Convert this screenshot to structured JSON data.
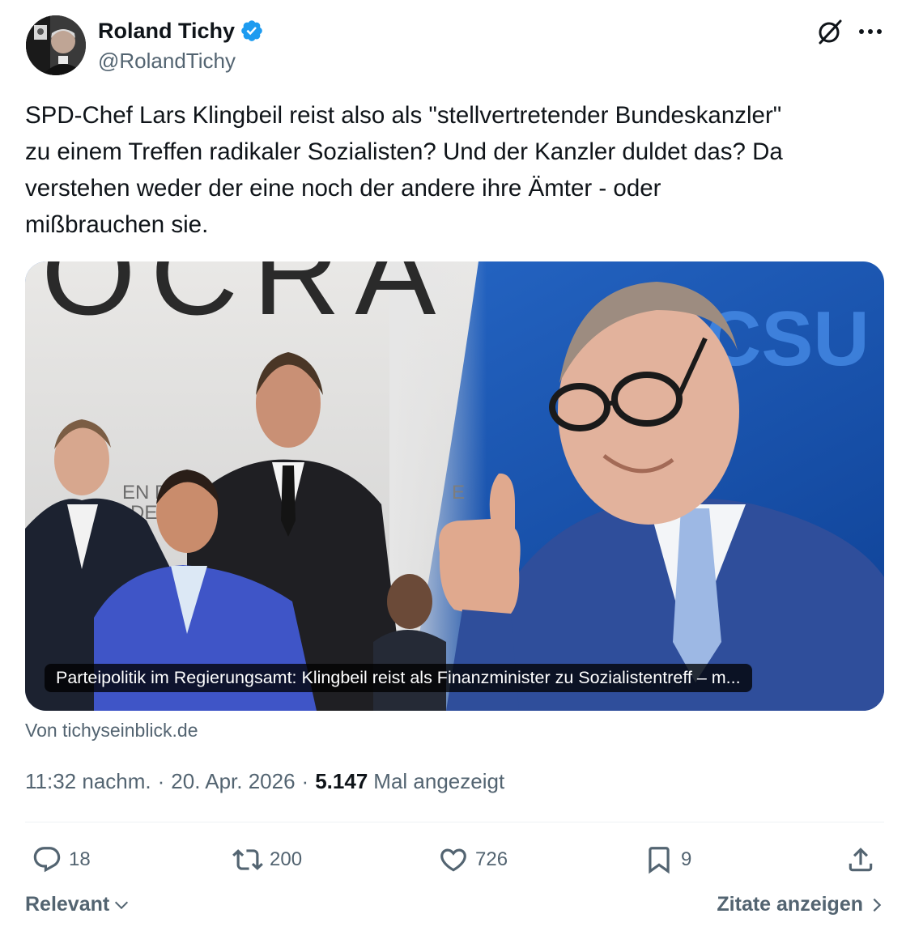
{
  "author": {
    "name": "Roland Tichy",
    "handle": "@RolandTichy",
    "verified": true,
    "badge_color": "#1d9bf0"
  },
  "tweet": {
    "text": "SPD-Chef Lars Klingbeil reist also als \"stellvertretender Bundeskanzler\"\nzu einem Treffen radikaler Sozialisten? Und der Kanzler duldet das? Da\nverstehen weder der eine noch der andere ihre Ämter - oder\nmißbrauchen sie."
  },
  "card": {
    "caption": "Parteipolitik im Regierungsamt: Klingbeil reist als Finanzminister zu Sozialistentreff – m...",
    "source": "Von tichyseinblick.de",
    "image_left_letters": "OCRA",
    "image_right_letters": "CSU",
    "image_backdrop_text_1": "EN D",
    "image_backdrop_text_2": "DE",
    "image_backdrop_text_3": "E"
  },
  "meta": {
    "time": "11:32 nachm.",
    "date": "20. Apr. 2026",
    "views_count": "5.147",
    "views_label": "Mal angezeigt",
    "separator": "·"
  },
  "actions": {
    "replies": "18",
    "reposts": "200",
    "likes": "726",
    "bookmarks": "9"
  },
  "footer": {
    "sort_label": "Relevant",
    "quotes_label": "Zitate anzeigen"
  },
  "colors": {
    "text_primary": "#0f1419",
    "text_secondary": "#536471",
    "divider": "#eff3f4"
  }
}
